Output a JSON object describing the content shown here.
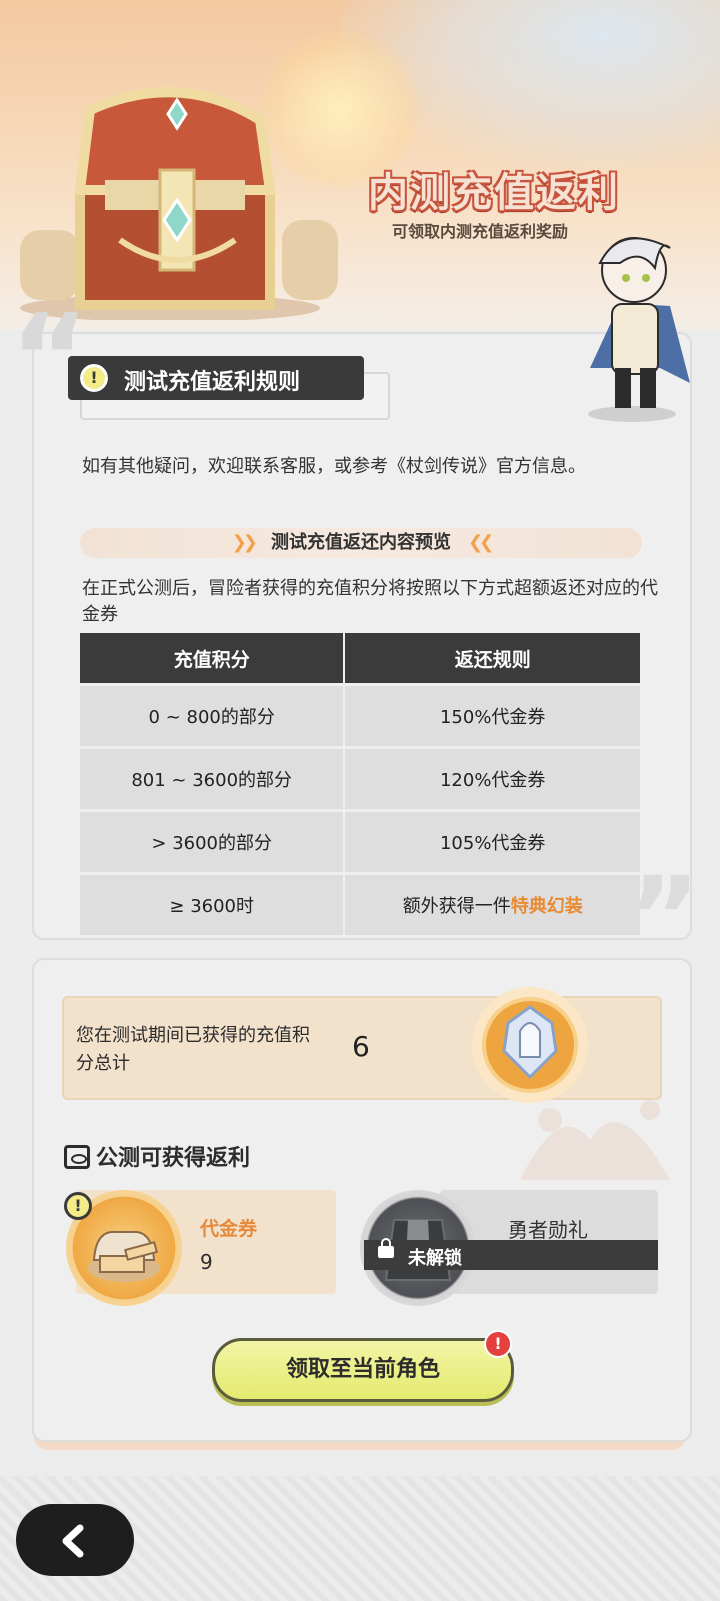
{
  "header": {
    "title": "内测充值返利",
    "subtitle": "可领取内测充值返利奖励"
  },
  "rules": {
    "heading": "测试充值返利规则",
    "note": "如有其他疑问，欢迎联系客服，或参考《杖剑传说》官方信息。",
    "preview_title": "测试充值返还内容预览",
    "description": "在正式公测后，冒险者获得的充值积分将按照以下方式超额返还对应的代金券",
    "table": {
      "headers": [
        "充值积分",
        "返还规则"
      ],
      "rows": [
        {
          "points": "0 ~ 800的部分",
          "rule": "150%代金券"
        },
        {
          "points": "801 ~ 3600的部分",
          "rule": "120%代金券"
        },
        {
          "points": "> 3600的部分",
          "rule": "105%代金券"
        },
        {
          "points": "≥  3600时",
          "rule_prefix": "额外获得一件",
          "rule_highlight": "特典幻装"
        }
      ]
    }
  },
  "summary": {
    "total_label": "您在测试期间已获得的充值积分总计",
    "total_value": "6"
  },
  "rebate": {
    "section_title": "公测可获得返利",
    "voucher": {
      "name": "代金券",
      "count": "9"
    },
    "bonus": {
      "name": "勇者勋礼",
      "lock_label": "未解锁"
    },
    "claim_button": "领取至当前角色",
    "claim_badge": "!"
  },
  "icons": {
    "warning": "exclamation-icon",
    "back": "chevron-left-icon",
    "lock": "lock-icon",
    "section": "gift-box-icon"
  },
  "colors": {
    "accent_orange": "#e88a32",
    "header_dark": "#3a3a3a",
    "claim_button": "#e4ea6e",
    "badge_red": "#e3403e"
  }
}
